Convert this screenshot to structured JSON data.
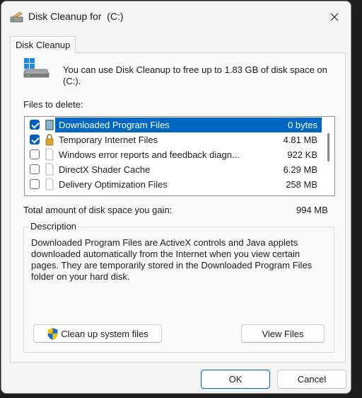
{
  "window": {
    "title": "Disk Cleanup for  (C:)"
  },
  "tabs": [
    {
      "label": "Disk Cleanup"
    }
  ],
  "info": {
    "text": "You can use Disk Cleanup to free up to 1.83 GB of disk space on (C:)."
  },
  "files": {
    "label": "Files to delete:",
    "items": [
      {
        "name": "Downloaded Program Files",
        "size": "0 bytes",
        "checked": true,
        "selected": true,
        "icon": "folder-icon"
      },
      {
        "name": "Temporary Internet Files",
        "size": "4.81 MB",
        "checked": true,
        "selected": false,
        "icon": "lock-icon"
      },
      {
        "name": "Windows error reports and feedback diagn...",
        "size": "922 KB",
        "checked": false,
        "selected": false,
        "icon": "file-icon"
      },
      {
        "name": "DirectX Shader Cache",
        "size": "6.29 MB",
        "checked": false,
        "selected": false,
        "icon": "file-icon"
      },
      {
        "name": "Delivery Optimization Files",
        "size": "258 MB",
        "checked": false,
        "selected": false,
        "icon": "file-icon"
      }
    ]
  },
  "total": {
    "label": "Total amount of disk space you gain:",
    "value": "994 MB"
  },
  "description": {
    "title": "Description",
    "text": "Downloaded Program Files are ActiveX controls and Java applets downloaded automatically from the Internet when you view certain pages. They are temporarily stored in the Downloaded Program Files folder on your hard disk."
  },
  "buttons": {
    "cleanup_system": "Clean up system files",
    "view_files": "View Files",
    "ok": "OK",
    "cancel": "Cancel"
  },
  "colors": {
    "accent": "#0067c0",
    "checkbox": "#005fb8"
  }
}
